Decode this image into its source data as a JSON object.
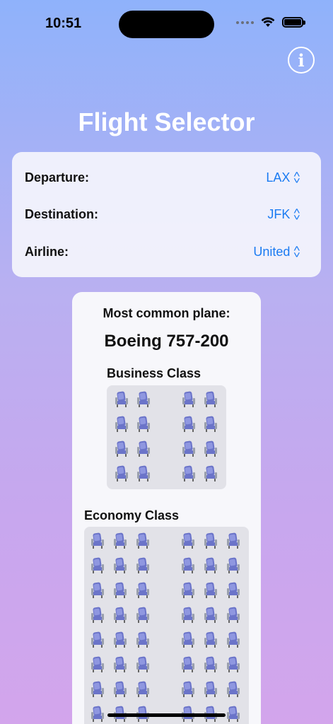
{
  "status_bar": {
    "time": "10:51"
  },
  "header": {
    "title": "Flight Selector",
    "info_icon": "info-icon"
  },
  "pickers": [
    {
      "label": "Departure:",
      "value": "LAX"
    },
    {
      "label": "Destination:",
      "value": "JFK"
    },
    {
      "label": "Airline:",
      "value": "United"
    }
  ],
  "plane": {
    "label": "Most common plane:",
    "name": "Boeing 757-200",
    "business": {
      "title": "Business Class",
      "rows": 4,
      "left_seats": 2,
      "right_seats": 2
    },
    "economy": {
      "title": "Economy Class",
      "rows": 8,
      "left_seats": 3,
      "right_seats": 3
    }
  },
  "colors": {
    "accent": "#1a7bf2",
    "seat_body": "#6b74c9",
    "seat_frame": "#9aa0ad"
  }
}
